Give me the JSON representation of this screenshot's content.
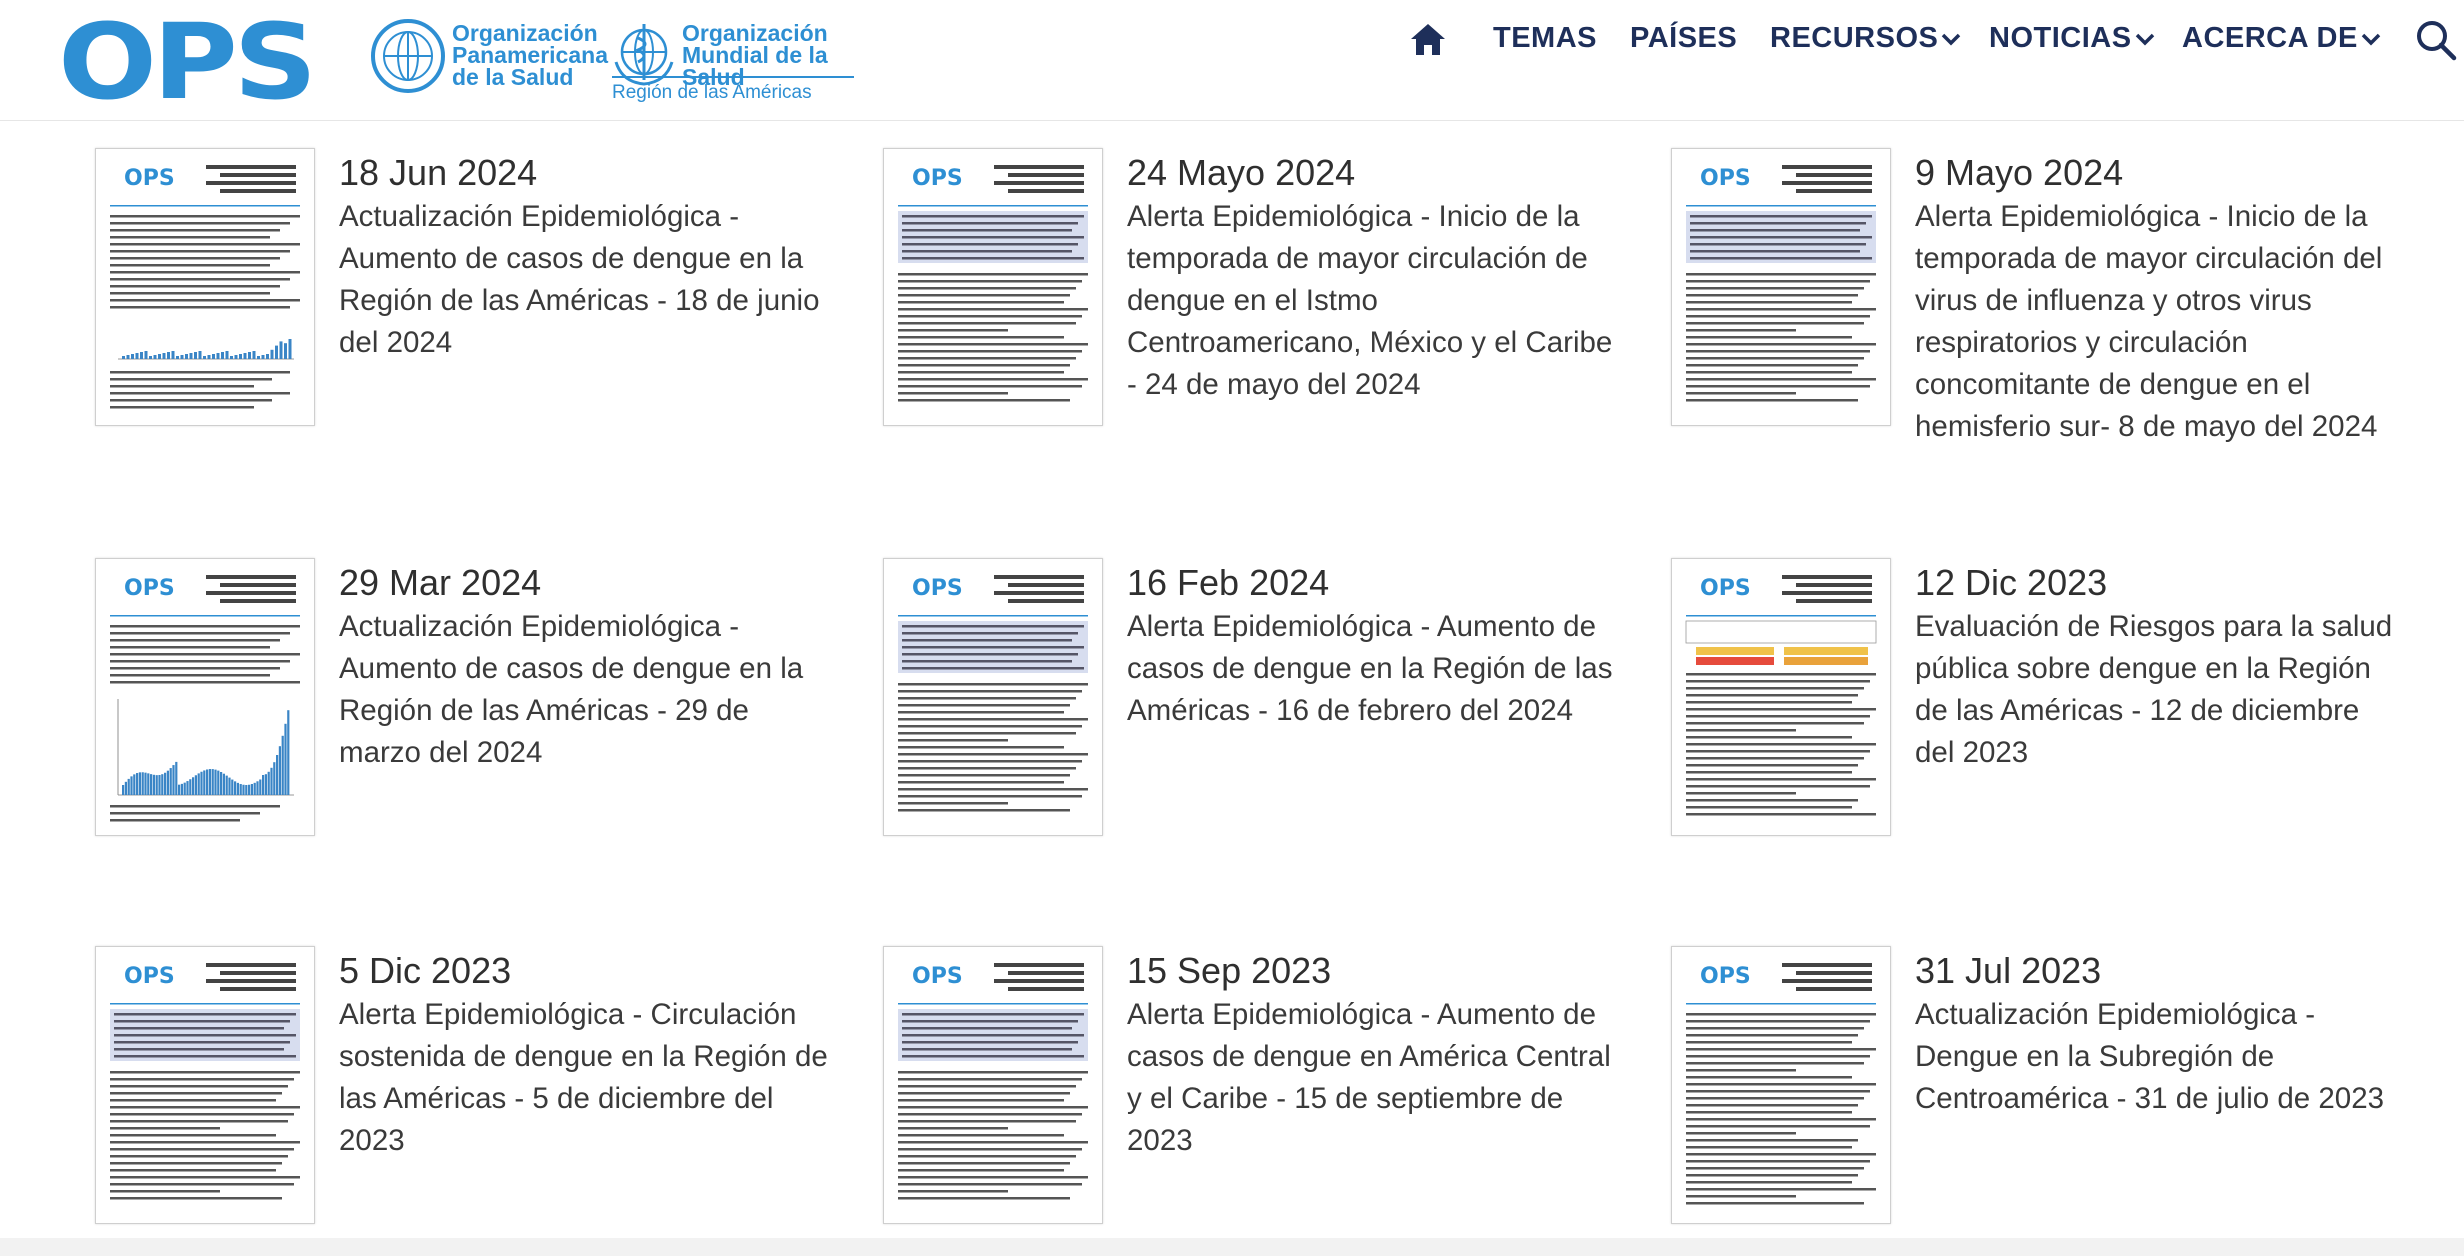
{
  "header": {
    "logo_text": "OPS",
    "paho_name": [
      "Organización",
      "Panamericana",
      "de la Salud"
    ],
    "who_name": [
      "Organización",
      "Mundial de la Salud"
    ],
    "who_region": "Región de las Américas",
    "nav": {
      "home_icon": "home-icon",
      "items": [
        {
          "label": "TEMAS",
          "dropdown": false
        },
        {
          "label": "PAÍSES",
          "dropdown": false
        },
        {
          "label": "RECURSOS",
          "dropdown": true
        },
        {
          "label": "NOTICIAS",
          "dropdown": true
        },
        {
          "label": "ACERCA DE",
          "dropdown": true
        }
      ],
      "search_icon": "search-icon"
    }
  },
  "colors": {
    "brand_blue": "#2e8fd3",
    "nav_text": "#1e2f5a",
    "body_text": "#3a3a3a"
  },
  "thumbnail_text": "OPS",
  "items": [
    {
      "date": "18 Jun 2024",
      "title": "Actualización Epidemiológica - Aumento de casos de dengue en la Región de las Américas - 18 de junio del 2024",
      "thumb": "update-bars"
    },
    {
      "date": "24 Mayo 2024",
      "title": "Alerta Epidemiológica - Inicio de la temporada de mayor circulación de dengue en el Istmo Centroamericano, México y el Caribe - 24 de mayo del 2024",
      "thumb": "alert-text"
    },
    {
      "date": "9 Mayo 2024",
      "title": "Alerta Epidemiológica - Inicio de la temporada de mayor circulación del virus de influenza y otros virus respiratorios y circulación concomitante de dengue en el hemisferio sur- 8 de mayo del 2024",
      "thumb": "alert-text"
    },
    {
      "date": "29 Mar 2024",
      "title": "Actualización Epidemiológica - Aumento de casos de dengue en la Región de las Américas - 29 de marzo del 2024",
      "thumb": "update-chart"
    },
    {
      "date": "16 Feb 2024",
      "title": "Alerta Epidemiológica - Aumento de casos de dengue en la Región de las Américas - 16 de febrero del 2024",
      "thumb": "alert-text"
    },
    {
      "date": "12 Dic 2023",
      "title": "Evaluación de Riesgos para la salud pública sobre dengue en la Región de las Américas - 12 de diciembre del 2023",
      "thumb": "risk-table"
    },
    {
      "date": "5 Dic 2023",
      "title": "Alerta Epidemiológica - Circulación sostenida de dengue en la Región de las Américas - 5 de diciembre del 2023",
      "thumb": "alert-text"
    },
    {
      "date": "15 Sep 2023",
      "title": "Alerta Epidemiológica - Aumento de casos de dengue en América Central y el Caribe - 15 de septiembre de 2023",
      "thumb": "alert-text"
    },
    {
      "date": "31 Jul 2023",
      "title": "Actualización Epidemiológica - Dengue en la Subregión de Centroamérica - 31 de julio de 2023",
      "thumb": "update-text"
    }
  ]
}
